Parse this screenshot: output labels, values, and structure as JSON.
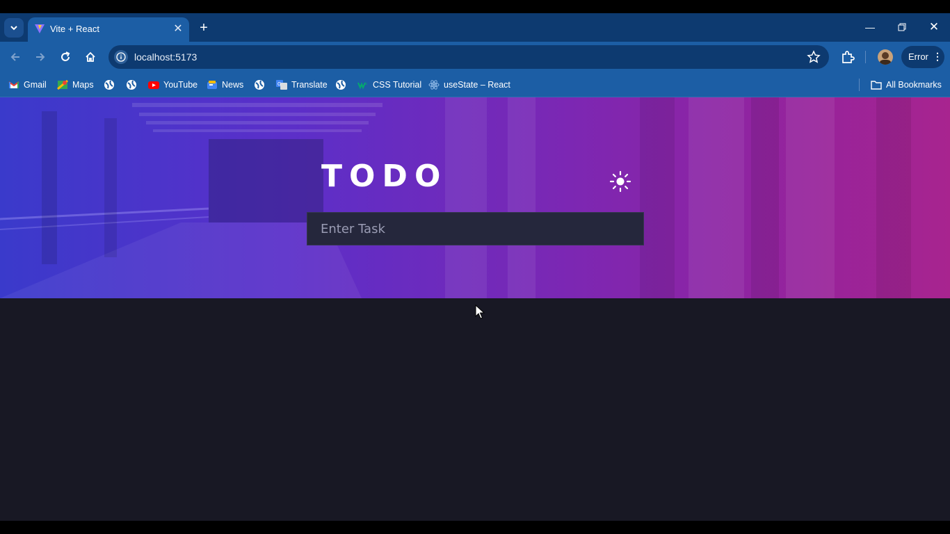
{
  "browser": {
    "tab": {
      "title": "Vite + React"
    },
    "url": "localhost:5173",
    "profile_status": "Error",
    "bookmarks": [
      {
        "label": "Gmail",
        "icon": "gmail-icon"
      },
      {
        "label": "Maps",
        "icon": "maps-icon"
      },
      {
        "label": "",
        "icon": "globe-icon"
      },
      {
        "label": "",
        "icon": "globe-icon"
      },
      {
        "label": "YouTube",
        "icon": "youtube-icon"
      },
      {
        "label": "News",
        "icon": "news-icon"
      },
      {
        "label": "",
        "icon": "globe-icon"
      },
      {
        "label": "Translate",
        "icon": "translate-icon"
      },
      {
        "label": "",
        "icon": "globe-icon"
      },
      {
        "label": "CSS Tutorial",
        "icon": "w3schools-icon"
      },
      {
        "label": "useState – React",
        "icon": "react-icon"
      }
    ],
    "all_bookmarks": "All Bookmarks"
  },
  "app": {
    "title": "TODO",
    "input_placeholder": "Enter Task",
    "theme_icon": "sun-icon"
  },
  "colors": {
    "page_bg": "#181824",
    "input_bg": "#25273c",
    "browser_frame": "#1c5ea5"
  }
}
